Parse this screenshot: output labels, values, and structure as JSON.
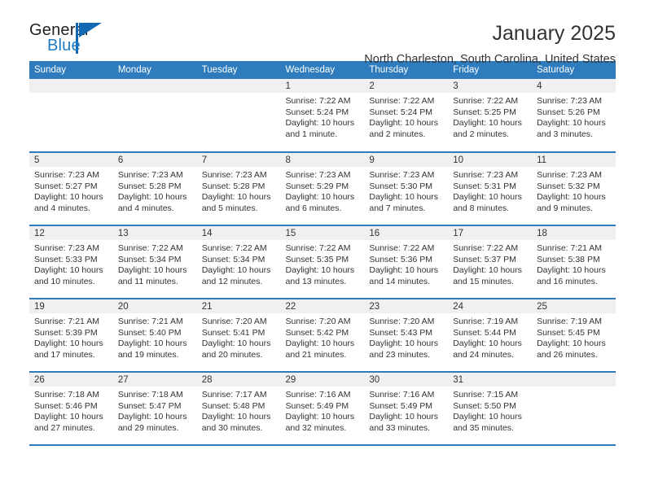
{
  "brand": {
    "name_primary": "General",
    "name_secondary": "Blue",
    "accent_color": "#1268b3"
  },
  "header": {
    "title": "January 2025",
    "subtitle": "North Charleston, South Carolina, United States"
  },
  "theme": {
    "header_blue": "#2e7cbd",
    "daynum_band": "#f0f0f0",
    "text": "#333333"
  },
  "calendar": {
    "weekday_headers": [
      "Sunday",
      "Monday",
      "Tuesday",
      "Wednesday",
      "Thursday",
      "Friday",
      "Saturday"
    ],
    "weeks": [
      [
        {
          "day": "",
          "sunrise": "",
          "sunset": "",
          "daylight1": "",
          "daylight2": ""
        },
        {
          "day": "",
          "sunrise": "",
          "sunset": "",
          "daylight1": "",
          "daylight2": ""
        },
        {
          "day": "",
          "sunrise": "",
          "sunset": "",
          "daylight1": "",
          "daylight2": ""
        },
        {
          "day": "1",
          "sunrise": "Sunrise: 7:22 AM",
          "sunset": "Sunset: 5:24 PM",
          "daylight1": "Daylight: 10 hours",
          "daylight2": "and 1 minute."
        },
        {
          "day": "2",
          "sunrise": "Sunrise: 7:22 AM",
          "sunset": "Sunset: 5:24 PM",
          "daylight1": "Daylight: 10 hours",
          "daylight2": "and 2 minutes."
        },
        {
          "day": "3",
          "sunrise": "Sunrise: 7:22 AM",
          "sunset": "Sunset: 5:25 PM",
          "daylight1": "Daylight: 10 hours",
          "daylight2": "and 2 minutes."
        },
        {
          "day": "4",
          "sunrise": "Sunrise: 7:23 AM",
          "sunset": "Sunset: 5:26 PM",
          "daylight1": "Daylight: 10 hours",
          "daylight2": "and 3 minutes."
        }
      ],
      [
        {
          "day": "5",
          "sunrise": "Sunrise: 7:23 AM",
          "sunset": "Sunset: 5:27 PM",
          "daylight1": "Daylight: 10 hours",
          "daylight2": "and 4 minutes."
        },
        {
          "day": "6",
          "sunrise": "Sunrise: 7:23 AM",
          "sunset": "Sunset: 5:28 PM",
          "daylight1": "Daylight: 10 hours",
          "daylight2": "and 4 minutes."
        },
        {
          "day": "7",
          "sunrise": "Sunrise: 7:23 AM",
          "sunset": "Sunset: 5:28 PM",
          "daylight1": "Daylight: 10 hours",
          "daylight2": "and 5 minutes."
        },
        {
          "day": "8",
          "sunrise": "Sunrise: 7:23 AM",
          "sunset": "Sunset: 5:29 PM",
          "daylight1": "Daylight: 10 hours",
          "daylight2": "and 6 minutes."
        },
        {
          "day": "9",
          "sunrise": "Sunrise: 7:23 AM",
          "sunset": "Sunset: 5:30 PM",
          "daylight1": "Daylight: 10 hours",
          "daylight2": "and 7 minutes."
        },
        {
          "day": "10",
          "sunrise": "Sunrise: 7:23 AM",
          "sunset": "Sunset: 5:31 PM",
          "daylight1": "Daylight: 10 hours",
          "daylight2": "and 8 minutes."
        },
        {
          "day": "11",
          "sunrise": "Sunrise: 7:23 AM",
          "sunset": "Sunset: 5:32 PM",
          "daylight1": "Daylight: 10 hours",
          "daylight2": "and 9 minutes."
        }
      ],
      [
        {
          "day": "12",
          "sunrise": "Sunrise: 7:23 AM",
          "sunset": "Sunset: 5:33 PM",
          "daylight1": "Daylight: 10 hours",
          "daylight2": "and 10 minutes."
        },
        {
          "day": "13",
          "sunrise": "Sunrise: 7:22 AM",
          "sunset": "Sunset: 5:34 PM",
          "daylight1": "Daylight: 10 hours",
          "daylight2": "and 11 minutes."
        },
        {
          "day": "14",
          "sunrise": "Sunrise: 7:22 AM",
          "sunset": "Sunset: 5:34 PM",
          "daylight1": "Daylight: 10 hours",
          "daylight2": "and 12 minutes."
        },
        {
          "day": "15",
          "sunrise": "Sunrise: 7:22 AM",
          "sunset": "Sunset: 5:35 PM",
          "daylight1": "Daylight: 10 hours",
          "daylight2": "and 13 minutes."
        },
        {
          "day": "16",
          "sunrise": "Sunrise: 7:22 AM",
          "sunset": "Sunset: 5:36 PM",
          "daylight1": "Daylight: 10 hours",
          "daylight2": "and 14 minutes."
        },
        {
          "day": "17",
          "sunrise": "Sunrise: 7:22 AM",
          "sunset": "Sunset: 5:37 PM",
          "daylight1": "Daylight: 10 hours",
          "daylight2": "and 15 minutes."
        },
        {
          "day": "18",
          "sunrise": "Sunrise: 7:21 AM",
          "sunset": "Sunset: 5:38 PM",
          "daylight1": "Daylight: 10 hours",
          "daylight2": "and 16 minutes."
        }
      ],
      [
        {
          "day": "19",
          "sunrise": "Sunrise: 7:21 AM",
          "sunset": "Sunset: 5:39 PM",
          "daylight1": "Daylight: 10 hours",
          "daylight2": "and 17 minutes."
        },
        {
          "day": "20",
          "sunrise": "Sunrise: 7:21 AM",
          "sunset": "Sunset: 5:40 PM",
          "daylight1": "Daylight: 10 hours",
          "daylight2": "and 19 minutes."
        },
        {
          "day": "21",
          "sunrise": "Sunrise: 7:20 AM",
          "sunset": "Sunset: 5:41 PM",
          "daylight1": "Daylight: 10 hours",
          "daylight2": "and 20 minutes."
        },
        {
          "day": "22",
          "sunrise": "Sunrise: 7:20 AM",
          "sunset": "Sunset: 5:42 PM",
          "daylight1": "Daylight: 10 hours",
          "daylight2": "and 21 minutes."
        },
        {
          "day": "23",
          "sunrise": "Sunrise: 7:20 AM",
          "sunset": "Sunset: 5:43 PM",
          "daylight1": "Daylight: 10 hours",
          "daylight2": "and 23 minutes."
        },
        {
          "day": "24",
          "sunrise": "Sunrise: 7:19 AM",
          "sunset": "Sunset: 5:44 PM",
          "daylight1": "Daylight: 10 hours",
          "daylight2": "and 24 minutes."
        },
        {
          "day": "25",
          "sunrise": "Sunrise: 7:19 AM",
          "sunset": "Sunset: 5:45 PM",
          "daylight1": "Daylight: 10 hours",
          "daylight2": "and 26 minutes."
        }
      ],
      [
        {
          "day": "26",
          "sunrise": "Sunrise: 7:18 AM",
          "sunset": "Sunset: 5:46 PM",
          "daylight1": "Daylight: 10 hours",
          "daylight2": "and 27 minutes."
        },
        {
          "day": "27",
          "sunrise": "Sunrise: 7:18 AM",
          "sunset": "Sunset: 5:47 PM",
          "daylight1": "Daylight: 10 hours",
          "daylight2": "and 29 minutes."
        },
        {
          "day": "28",
          "sunrise": "Sunrise: 7:17 AM",
          "sunset": "Sunset: 5:48 PM",
          "daylight1": "Daylight: 10 hours",
          "daylight2": "and 30 minutes."
        },
        {
          "day": "29",
          "sunrise": "Sunrise: 7:16 AM",
          "sunset": "Sunset: 5:49 PM",
          "daylight1": "Daylight: 10 hours",
          "daylight2": "and 32 minutes."
        },
        {
          "day": "30",
          "sunrise": "Sunrise: 7:16 AM",
          "sunset": "Sunset: 5:49 PM",
          "daylight1": "Daylight: 10 hours",
          "daylight2": "and 33 minutes."
        },
        {
          "day": "31",
          "sunrise": "Sunrise: 7:15 AM",
          "sunset": "Sunset: 5:50 PM",
          "daylight1": "Daylight: 10 hours",
          "daylight2": "and 35 minutes."
        },
        {
          "day": "",
          "sunrise": "",
          "sunset": "",
          "daylight1": "",
          "daylight2": ""
        }
      ]
    ]
  }
}
